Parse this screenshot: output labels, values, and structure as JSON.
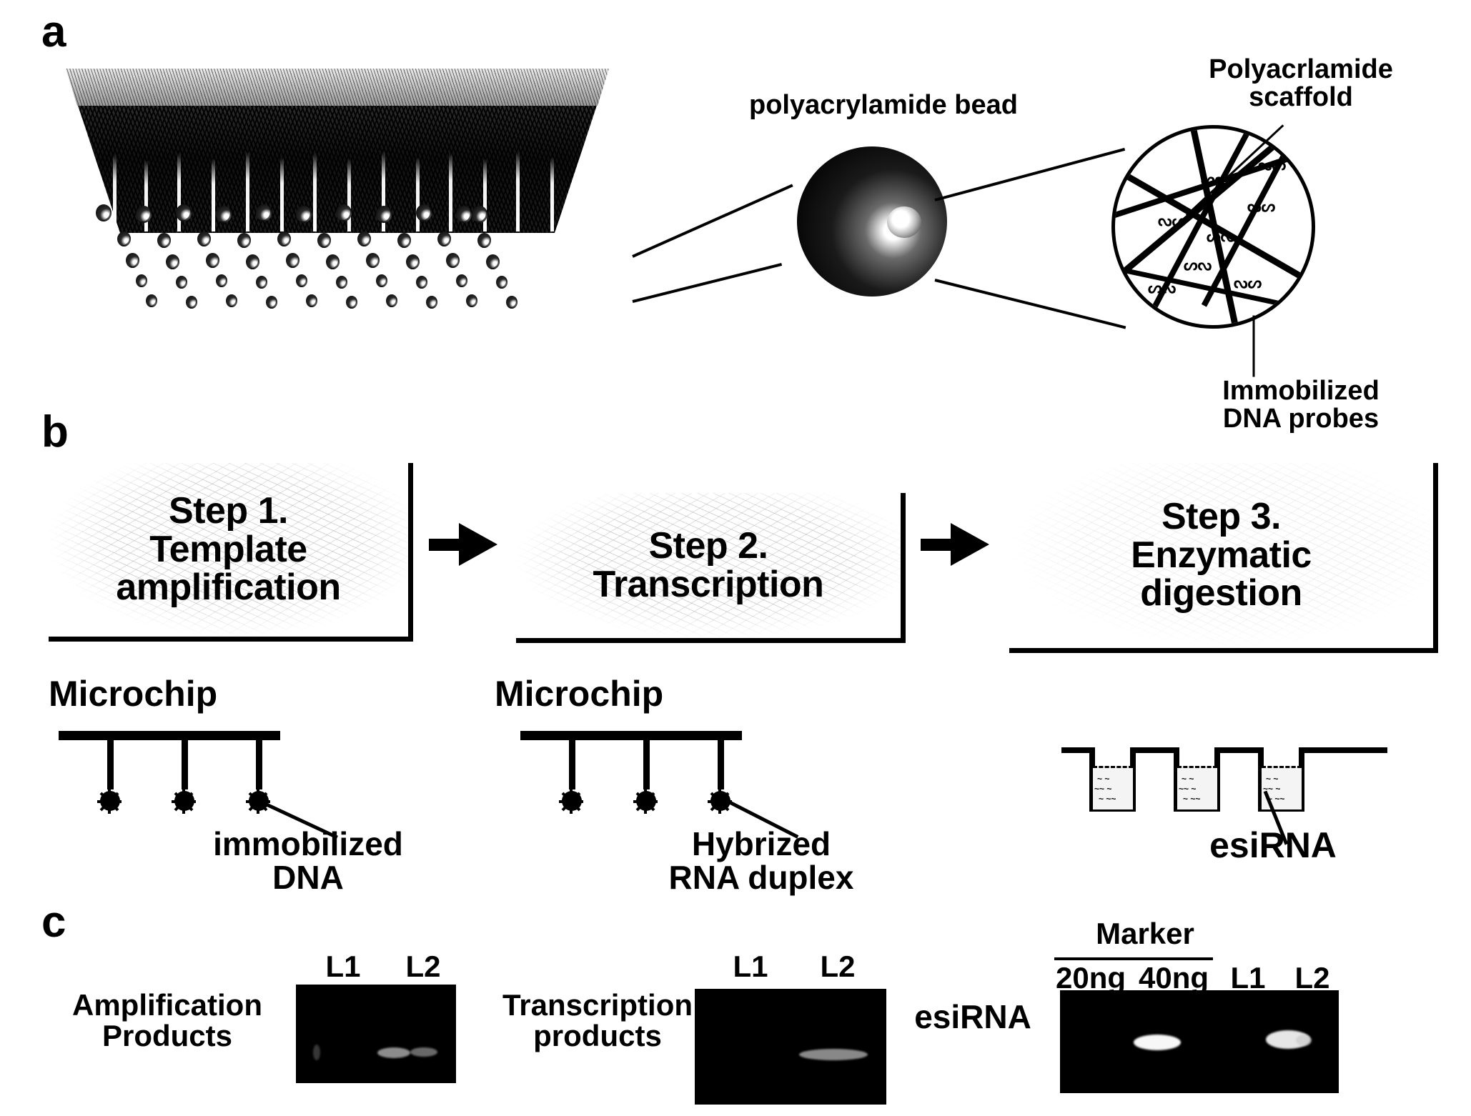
{
  "figure": {
    "panel_a_letter": "a",
    "panel_b_letter": "b",
    "panel_c_letter": "c"
  },
  "panel_a": {
    "bead_label": "polyacrylamide bead",
    "scaffold_label_line1": "Polyacrlamide",
    "scaffold_label_line2": "scaffold",
    "probes_label_line1": "Immobilized",
    "probes_label_line2": "DNA probes"
  },
  "panel_b": {
    "steps": [
      {
        "number": "Step 1.",
        "line2": "Template",
        "line3": "amplification"
      },
      {
        "number": "Step 2.",
        "line2": "Transcription",
        "line3": ""
      },
      {
        "number": "Step 3.",
        "line2": "Enzymatic",
        "line3": "digestion"
      }
    ],
    "arrow_glyph": "arrow-right-icon",
    "schematics": [
      {
        "surface_label": "Microchip",
        "callout_line1": "immobilized",
        "callout_line2": "DNA"
      },
      {
        "surface_label": "Microchip",
        "callout_line1": "Hybrized",
        "callout_line2": "RNA duplex"
      },
      {
        "surface_label": "",
        "callout_line1": "esiRNA",
        "callout_line2": ""
      }
    ]
  },
  "panel_c": {
    "gels": [
      {
        "row_label_line1": "Amplification",
        "row_label_line2": "Products",
        "lane_headers": [
          "L1",
          "L2"
        ],
        "marker_group_label": "",
        "bands": [
          {
            "lane": "L2",
            "intensity": "faint"
          },
          {
            "lane": "L2b",
            "intensity": "faint"
          }
        ]
      },
      {
        "row_label_line1": "Transcription",
        "row_label_line2": "products",
        "lane_headers": [
          "L1",
          "L2"
        ],
        "marker_group_label": "",
        "bands": [
          {
            "lane": "L2",
            "intensity": "faint"
          }
        ]
      },
      {
        "row_label_line1": "esiRNA",
        "row_label_line2": "",
        "marker_group_label": "Marker",
        "lane_headers": [
          "20ng",
          "40ng",
          "L1",
          "L2"
        ],
        "bands": [
          {
            "lane": "40ng",
            "intensity": "bright"
          },
          {
            "lane": "L2",
            "intensity": "bright"
          }
        ]
      }
    ]
  },
  "colors": {
    "ink": "#000000",
    "paper": "#ffffff",
    "gel_background": "#000000",
    "band": "#ffffff",
    "liquid": "#f4f4f4"
  }
}
